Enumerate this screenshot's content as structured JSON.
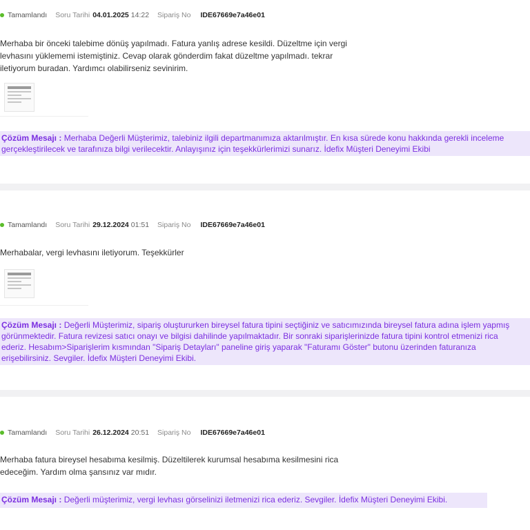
{
  "questions": [
    {
      "status": "Tamamlandı",
      "date_label": "Soru Tarihi",
      "date": "04.01.2025",
      "time": "14:22",
      "order_label": "Sipariş No",
      "order_no": "IDE67669e7a46e01",
      "message_lines": [
        "Merhaba bir önceki talebime dönüş yapılmadı. Fatura yanlış adrese kesildi. Düzeltme için vergi",
        "levhasını yüklememi istemiştiniz. Cevap olarak gönderdim fakat düzeltme yapılmadı. tekrar",
        "iletiyorum buradan. Yardımcı olabilirseniz sevinirim."
      ],
      "has_attachment": true,
      "solution_label": "Çözüm Mesajı :",
      "solution_lines": [
        "Merhaba Değerli Müşterimiz, talebiniz ilgili departmanımıza aktarılmıştır. En kısa sürede konu hakkında gerekli inceleme",
        "gerçekleştirilecek ve tarafınıza bilgi verilecektir. Anlayışınız için teşekkürlerimizi sunarız. İdefix Müşteri Deneyimi Ekibi"
      ]
    },
    {
      "status": "Tamamlandı",
      "date_label": "Soru Tarihi",
      "date": "29.12.2024",
      "time": "01:51",
      "order_label": "Sipariş No",
      "order_no": "IDE67669e7a46e01",
      "message_lines": [
        "Merhabalar, vergi levhasını iletiyorum. Teşekkürler"
      ],
      "has_attachment": true,
      "solution_label": "Çözüm Mesajı :",
      "solution_lines": [
        "Değerli Müşterimiz, sipariş oluştururken bireysel fatura tipini seçtiğiniz ve satıcımızında bireysel fatura adına işlem yapmış",
        "görünmektedir. Fatura revizesi satıcı onayı ve bilgisi dahilinde yapılmaktadır. Bir sonraki siparişlerinizde fatura tipini kontrol etmenizi rica",
        "ederiz. Hesabım>Siparişlerim kısmından \"Sipariş Detayları\" paneline giriş yaparak \"Faturamı Göster\" butonu üzerinden faturanıza",
        "erişebilirsiniz. Sevgiler. İdefix Müşteri Deneyimi Ekibi."
      ]
    },
    {
      "status": "Tamamlandı",
      "date_label": "Soru Tarihi",
      "date": "26.12.2024",
      "time": "20:51",
      "order_label": "Sipariş No",
      "order_no": "IDE67669e7a46e01",
      "message_lines": [
        "Merhaba fatura bireysel hesabıma kesilmiş. Düzeltilerek kurumsal hesabıma kesilmesini rica",
        "edeceğim. Yardım olma şansınız var mıdır."
      ],
      "has_attachment": false,
      "solution_label": "Çözüm Mesajı :",
      "solution_lines": [
        "Değerli müşterimiz, vergi levhası görselinizi iletmenizi rica ederiz. Sevgiler. İdefix Müşteri Deneyimi Ekibi."
      ]
    }
  ],
  "colors": {
    "status_dot": "#5bbd2b",
    "solution_bg": "#ede6fb",
    "solution_text": "#7b2fe0",
    "separator": "#f1f1f3"
  }
}
